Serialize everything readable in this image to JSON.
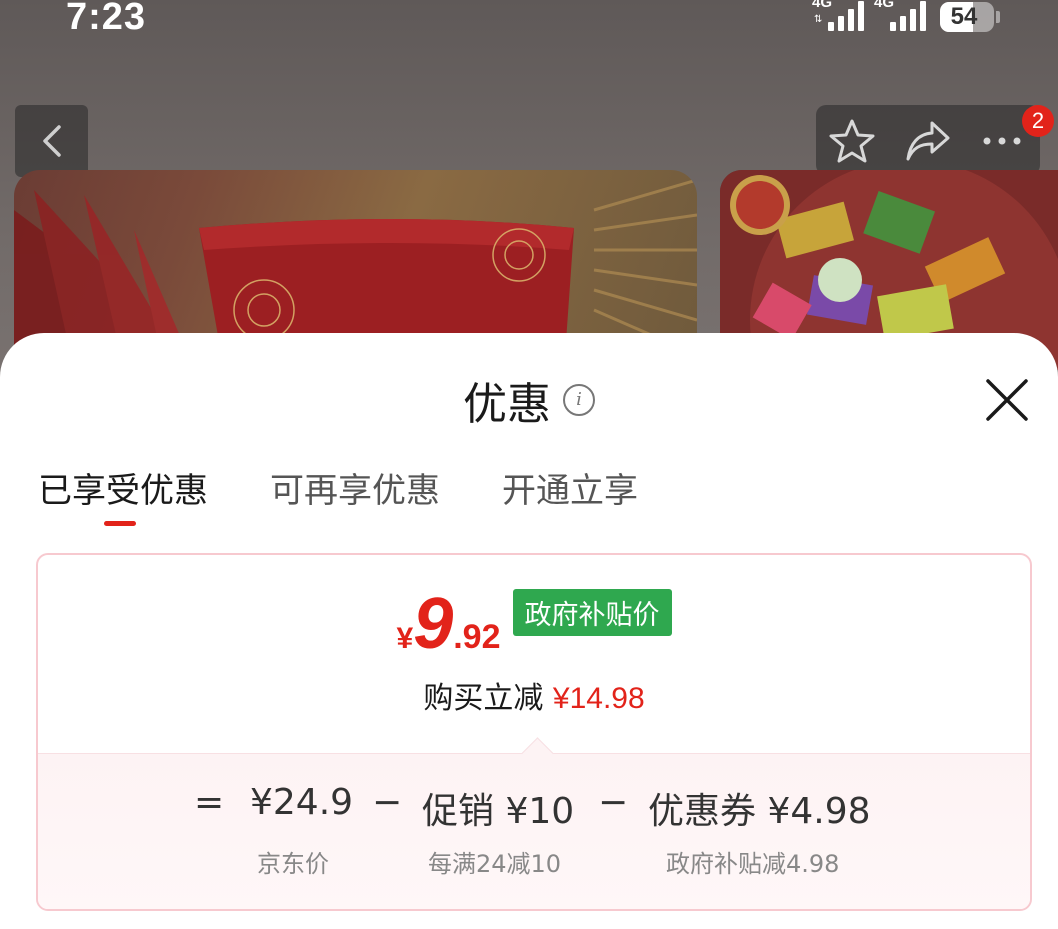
{
  "status_bar": {
    "time": "7:23",
    "network_1": "4G",
    "network_2": "4G",
    "battery": "54"
  },
  "top_nav": {
    "cart_badge": "2"
  },
  "sheet": {
    "title": "优惠",
    "tabs": [
      {
        "label": "已享受优惠",
        "active": true
      },
      {
        "label": "可再享优惠",
        "active": false
      },
      {
        "label": "开通立享",
        "active": false
      }
    ],
    "price": {
      "currency": "¥",
      "integer": "9",
      "decimal": ".92",
      "tag": "政府补贴价"
    },
    "instant_reduction": {
      "label": "购买立减",
      "amount": "¥14.98"
    },
    "breakdown": {
      "equals": "=",
      "minus_1": "−",
      "minus_2": "−",
      "base_price": "¥24.9",
      "base_label": "京东价",
      "promo_title": "促销 ¥10",
      "promo_note": "每满24减10",
      "coupon_title": "优惠券 ¥4.98",
      "coupon_note": "政府补贴减4.98"
    }
  },
  "colors": {
    "accent_red": "#e2231a",
    "gov_green": "#2fa84f",
    "card_border": "#f7c9cf"
  },
  "icons": [
    "back-arrow-icon",
    "star-icon",
    "share-icon",
    "more-icon",
    "info-icon",
    "close-icon",
    "battery-icon",
    "signal-icon"
  ]
}
